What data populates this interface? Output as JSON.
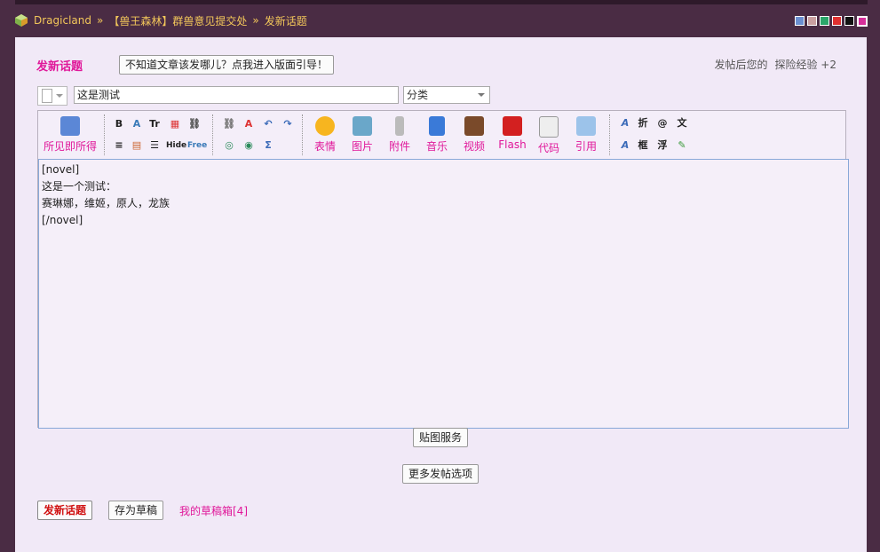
{
  "breadcrumb": {
    "site": "Dragicland",
    "sep": "»",
    "forum": "【兽王森林】群兽意见提交处",
    "current": "发新话题"
  },
  "style_swatches": [
    "#6b8fd0",
    "#c9a0a0",
    "#2ba66a",
    "#e03030",
    "#111111",
    "#d62f9a"
  ],
  "header": {
    "title": "发新话题",
    "guide_button": "不知道文章该发哪儿？点我进入版面引导！",
    "exp_text": "发帖后您的",
    "exp_label": "探险经验 +2"
  },
  "form": {
    "subject_value": "这是测试",
    "category_value": "分类"
  },
  "toolbar": {
    "wysiwyg": "所见即所得",
    "emoji": "表情",
    "image": "图片",
    "attach": "附件",
    "music": "音乐",
    "video": "视频",
    "flash": "Flash",
    "code": "代码",
    "quote": "引用",
    "small": {
      "bold": "B",
      "size": "Tr",
      "hide": "Hide",
      "free": "Free",
      "fold": "折",
      "at": "@",
      "wen": "文",
      "frame": "框",
      "float": "浮"
    }
  },
  "editor": {
    "lines": [
      "[novel]",
      "这是一个测试：",
      "赛琳娜，维姬，原人，龙族",
      "[/novel]"
    ]
  },
  "buttons": {
    "paste_image": "贴图服务",
    "more_options": "更多发帖选项",
    "submit": "发新话题",
    "save_draft": "存为草稿",
    "my_drafts": "我的草稿箱[4]"
  }
}
